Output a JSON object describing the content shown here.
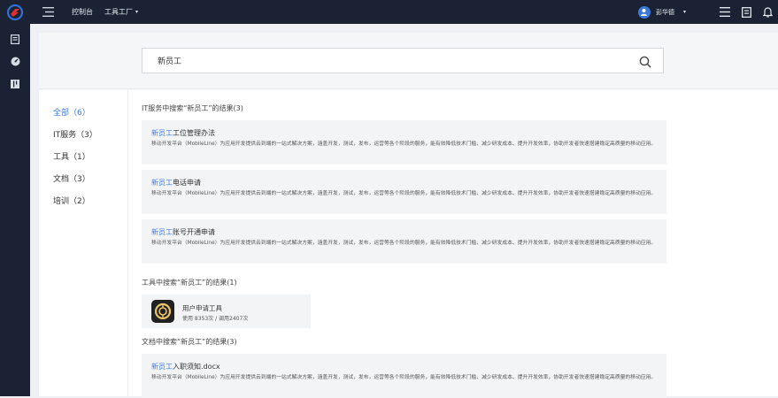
{
  "topbar": {
    "nav": [
      {
        "label": "控制台"
      },
      {
        "label": "工具工厂",
        "caret": "▾"
      }
    ],
    "user": {
      "name": "彭华德",
      "caret": "▾"
    },
    "icons": [
      "grid-menu-icon",
      "document-icon",
      "bell-icon"
    ]
  },
  "rail": {
    "items": [
      "book-icon",
      "gauge-icon",
      "columns-icon"
    ]
  },
  "search": {
    "value": "新员工"
  },
  "filters": [
    {
      "label": "全部（6）",
      "active": true
    },
    {
      "label": "IT服务（3）"
    },
    {
      "label": "工具（1）"
    },
    {
      "label": "文档（3）"
    },
    {
      "label": "培训（2）"
    }
  ],
  "sections": {
    "it": {
      "title": "IT服务中搜索“新员工”的结果(3)",
      "cards": [
        {
          "highlight": "新员工",
          "rest": "工位管理办法",
          "desc": "移动开发平台（MobileLine）为应用开发提供云到端的一站式解决方案，涵盖开发，测试，发布，运营等各个阶段的服务，能有效降低技术门槛、减少研发成本、提升开发效率，协助开发者快速搭建稳定高质量的移动应用。"
        },
        {
          "highlight": "新员工",
          "rest": "电话申请",
          "desc": "移动开发平台（MobileLine）为应用开发提供云到端的一站式解决方案，涵盖开发，测试，发布，运营等各个阶段的服务，能有效降低技术门槛、减少研发成本、提升开发效率，协助开发者快速搭建稳定高质量的移动应用。"
        },
        {
          "highlight": "新员工",
          "rest": "账号开通申请",
          "desc": "移动开发平台（MobileLine）为应用开发提供云到端的一站式解决方案，涵盖开发，测试，发布，运营等各个阶段的服务，能有效降低技术门槛、减少研发成本、提升开发效率，协助开发者快速搭建稳定高质量的移动应用。"
        }
      ]
    },
    "tools": {
      "title": "工具中搜索“新员工”的结果(1)",
      "items": [
        {
          "name": "用户申请工具",
          "meta": "使用 8353次 / 调用2407次"
        }
      ]
    },
    "docs": {
      "title": "文档中搜索“新员工”的结果(3)",
      "cards": [
        {
          "highlight": "新员工",
          "rest": "入职须知.docx",
          "desc": "移动开发平台（MobileLine）为应用开发提供云到端的一站式解决方案，涵盖开发，测试，发布，运营等各个阶段的服务，能有效降低技术门槛、减少研发成本、提升开发效率，协助开发者快速搭建稳定高质量的移动应用。"
        }
      ]
    }
  },
  "colors": {
    "topbar": "#1b2233",
    "accent": "#3d7be0",
    "card": "#f3f4f6"
  }
}
